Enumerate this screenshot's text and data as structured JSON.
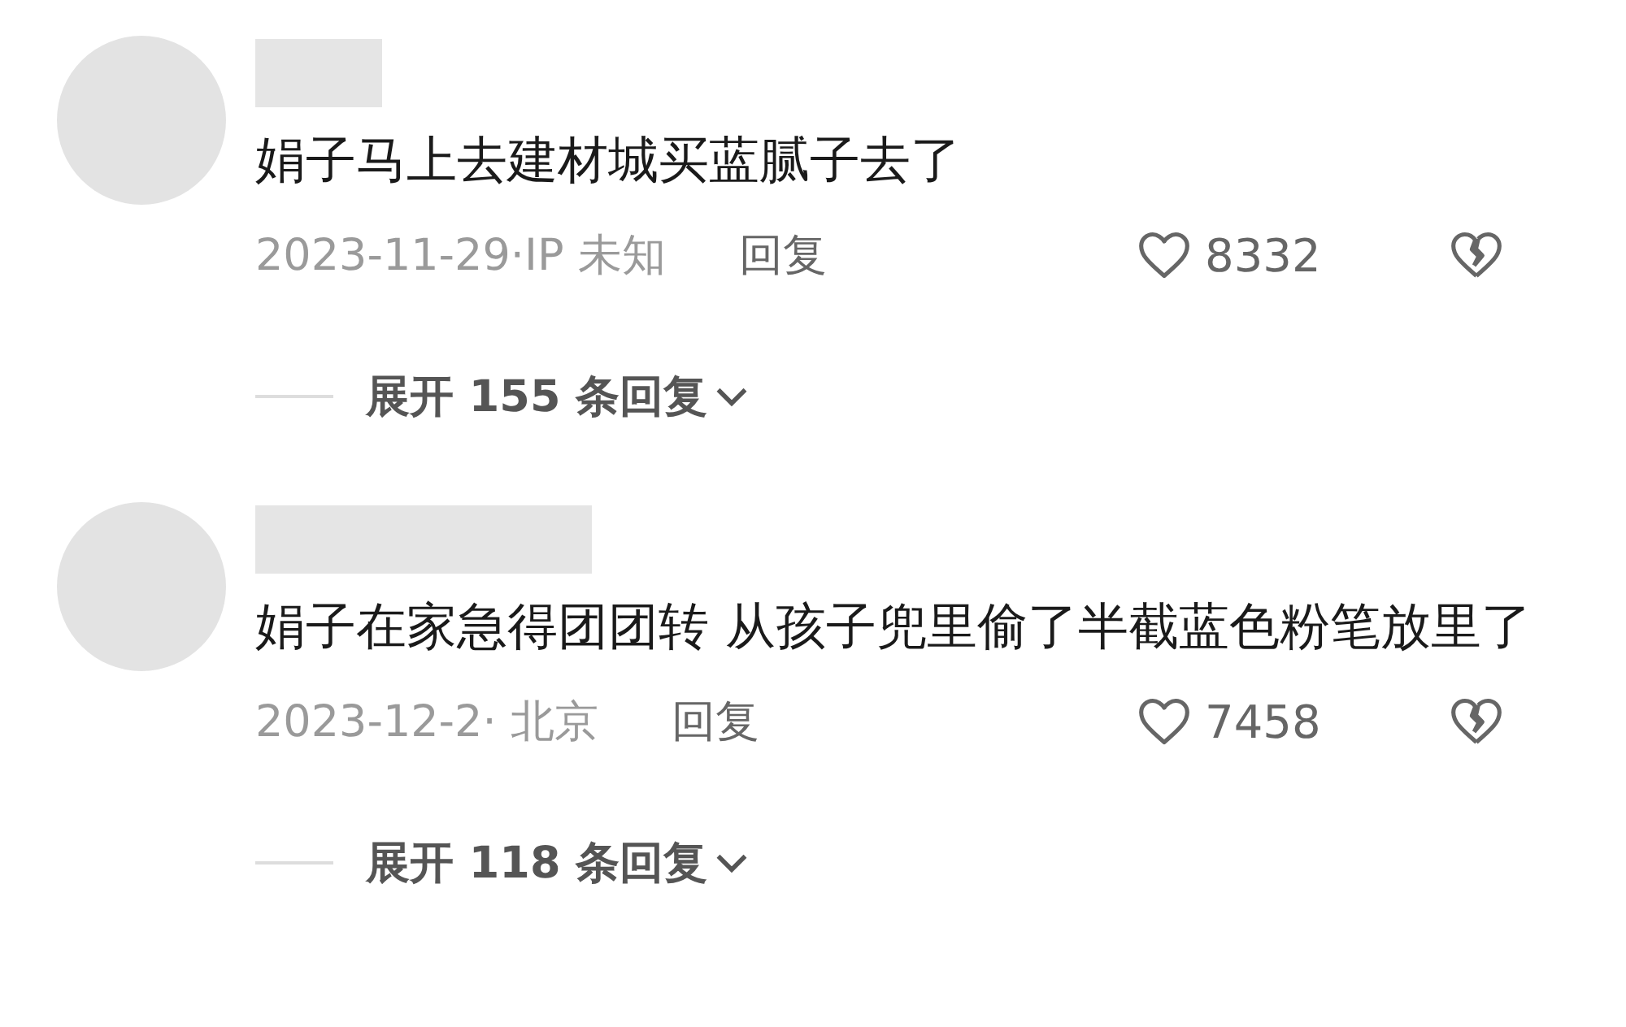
{
  "comments": [
    {
      "text": "娟子马上去建材城买蓝腻子去了",
      "meta": "2023-11-29·IP 未知",
      "reply": "回复",
      "likes": "8332",
      "expand": "展开 155 条回复"
    },
    {
      "text": "娟子在家急得团团转 从孩子兜里偷了半截蓝色粉笔放里了",
      "meta": "2023-12-2· 北京",
      "reply": "回复",
      "likes": "7458",
      "expand": "展开 118 条回复"
    }
  ]
}
